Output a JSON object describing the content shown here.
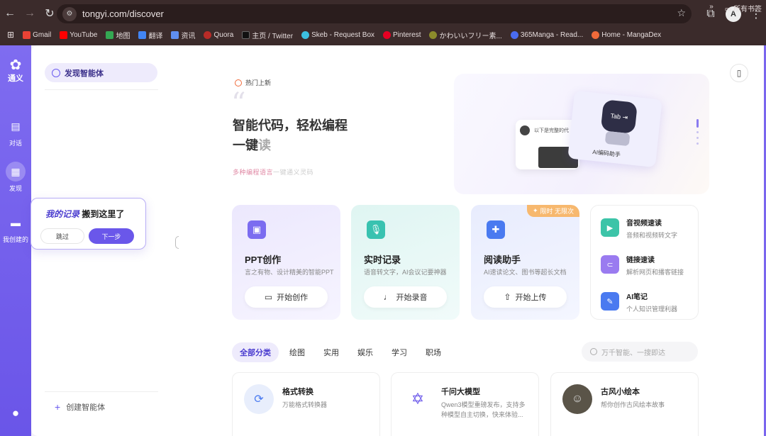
{
  "browser": {
    "url": "tongyi.com/discover",
    "bookmarks": [
      {
        "label": "Gmail",
        "color": "#e94235"
      },
      {
        "label": "YouTube",
        "color": "#ff0000"
      },
      {
        "label": "地图",
        "color": "#34a853"
      },
      {
        "label": "翻译",
        "color": "#4285f4"
      },
      {
        "label": "资讯",
        "color": "#5f8ef0"
      },
      {
        "label": "Quora",
        "color": "#b92b27"
      },
      {
        "label": "主页 / Twitter",
        "color": "#111111"
      },
      {
        "label": "Skeb - Request Box",
        "color": "#3cc0e0"
      },
      {
        "label": "Pinterest",
        "color": "#e60023"
      },
      {
        "label": "かわいいフリー素...",
        "color": "#8b8b2b"
      },
      {
        "label": "365Manga - Read...",
        "color": "#4a6cf0"
      },
      {
        "label": "Home - MangaDex",
        "color": "#f06a3a"
      }
    ],
    "more_bookmarks": "»",
    "all_bookmarks": "所有书签"
  },
  "rail": {
    "logo_text": "通义",
    "items": [
      {
        "label": "对话",
        "icon": "chat-icon"
      },
      {
        "label": "发现",
        "icon": "grid-icon"
      },
      {
        "label": "我创建的",
        "icon": "folder-icon"
      }
    ]
  },
  "panel": {
    "discover_label": "发现智能体",
    "create_agent": "创建智能体"
  },
  "hero": {
    "hot_tag": "热门上新",
    "title_line1": "智能代码，轻松编程",
    "title_line2_a": "一键",
    "title_line2_b": "读",
    "subtitle_a": "多种编程语言",
    "subtitle_b": "一键通义灵码",
    "robot_tab": "Tab ⇥",
    "robot_label": "AI编码助手",
    "code_text": "以下是完整的代"
  },
  "features": [
    {
      "title": "PPT创作",
      "desc": "言之有物、设计精美的智能PPT",
      "button": "开始创作",
      "icon_color": "#7b6cf0"
    },
    {
      "title": "实时记录",
      "desc": "语音转文字，AI会议记要神器",
      "button": "开始录音",
      "icon_color": "#39c2b0"
    },
    {
      "title": "阅读助手",
      "desc": "AI速读论文、图书等超长文档",
      "button": "开始上传",
      "icon_color": "#4a7af0",
      "badge": "限时 无限次"
    }
  ],
  "quick_list": [
    {
      "title": "音视频速读",
      "desc": "音频和视频转文字",
      "color": "#3cc4a8"
    },
    {
      "title": "链接速读",
      "desc": "解析网页和播客链接",
      "color": "#9a7bf0"
    },
    {
      "title": "AI笔记",
      "desc": "个人知识管理利器",
      "color": "#4a7af0"
    }
  ],
  "tabs": [
    "全部分类",
    "绘图",
    "实用",
    "娱乐",
    "学习",
    "职场"
  ],
  "search_placeholder": "万千智能、一搜即达",
  "agents": [
    {
      "title": "格式转换",
      "desc": "万能格式转换器",
      "icon": "convert-icon"
    },
    {
      "title": "千问大模型",
      "desc": "Qwen3模型重磅发布，支持多种模型自主切换，快来体验...",
      "icon": "qwen-icon"
    },
    {
      "title": "古风小绘本",
      "desc": "帮你创作古风绘本故事",
      "icon": "portrait-icon"
    }
  ],
  "tip": {
    "title_highlight": "我的记录",
    "title_rest": "搬到这里了",
    "skip": "跳过",
    "next": "下一步"
  }
}
